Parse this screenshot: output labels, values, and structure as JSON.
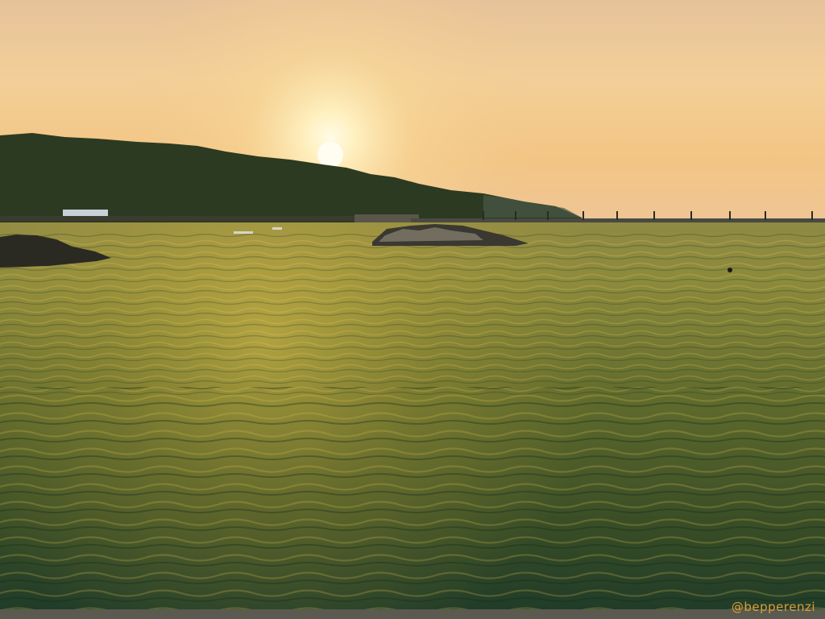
{
  "photo": {
    "subject": "sunset-over-harbor",
    "watermark": "@bepperenzi",
    "colors": {
      "sky_top": "#e9c79a",
      "sky_glow": "#fff3c8",
      "sky_horizon": "#f0c07a",
      "hill": "#2b3a22",
      "water_light": "#8a8a3a",
      "water_dark": "#1f3d2a",
      "rocks": "#2a2a24",
      "watermark": "#e8a23a"
    }
  }
}
